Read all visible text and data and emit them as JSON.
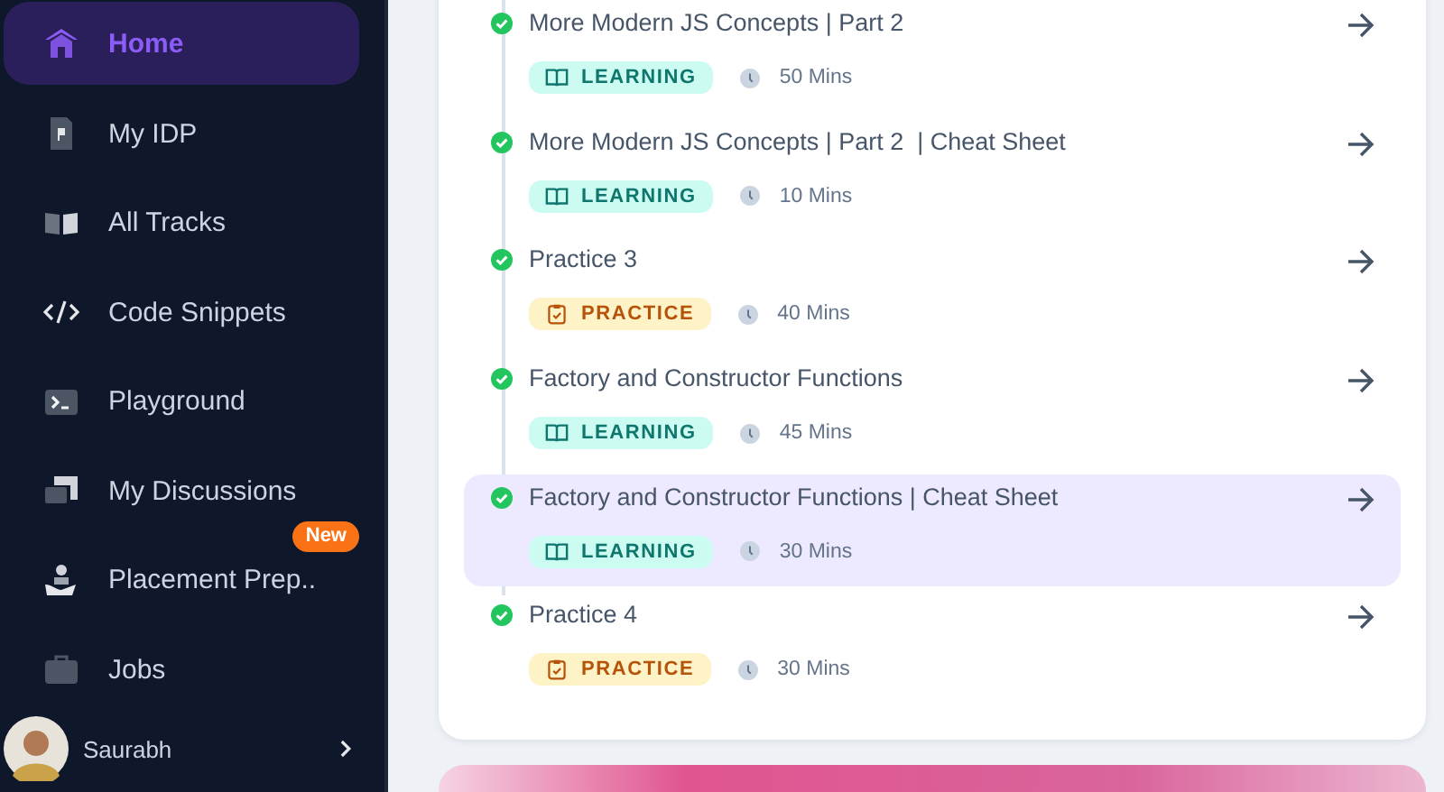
{
  "sidebar": {
    "items": [
      {
        "kind": "home",
        "label": "Home",
        "selected": true
      },
      {
        "kind": "idp",
        "label": "My IDP",
        "selected": false
      },
      {
        "kind": "tracks",
        "label": "All Tracks",
        "selected": false
      },
      {
        "kind": "code",
        "label": "Code Snippets",
        "selected": false
      },
      {
        "kind": "terminal",
        "label": "Playground",
        "selected": false
      },
      {
        "kind": "discussions",
        "label": "My Discussions",
        "selected": false
      },
      {
        "kind": "placement",
        "label": "Placement Prep..",
        "selected": false,
        "badge": "New"
      },
      {
        "kind": "jobs",
        "label": "Jobs",
        "selected": false
      }
    ],
    "profile": {
      "name": "Saurabh"
    }
  },
  "lessons": [
    {
      "title": "More Modern JS Concepts | Part 2",
      "kind": "learning",
      "tag": "LEARNING",
      "duration": "50 Mins",
      "completed": true,
      "selected": false
    },
    {
      "title": "More Modern JS Concepts | Part 2  | Cheat Sheet",
      "kind": "learning",
      "tag": "LEARNING",
      "duration": "10 Mins",
      "completed": true,
      "selected": false
    },
    {
      "title": "Practice 3",
      "kind": "practice",
      "tag": "PRACTICE",
      "duration": "40 Mins",
      "completed": true,
      "selected": false
    },
    {
      "title": "Factory and Constructor Functions",
      "kind": "learning",
      "tag": "LEARNING",
      "duration": "45 Mins",
      "completed": true,
      "selected": false
    },
    {
      "title": "Factory and Constructor Functions | Cheat Sheet",
      "kind": "learning",
      "tag": "LEARNING",
      "duration": "30 Mins",
      "completed": true,
      "selected": true
    },
    {
      "title": "Practice 4",
      "kind": "practice",
      "tag": "PRACTICE",
      "duration": "30 Mins",
      "completed": true,
      "selected": false
    }
  ]
}
